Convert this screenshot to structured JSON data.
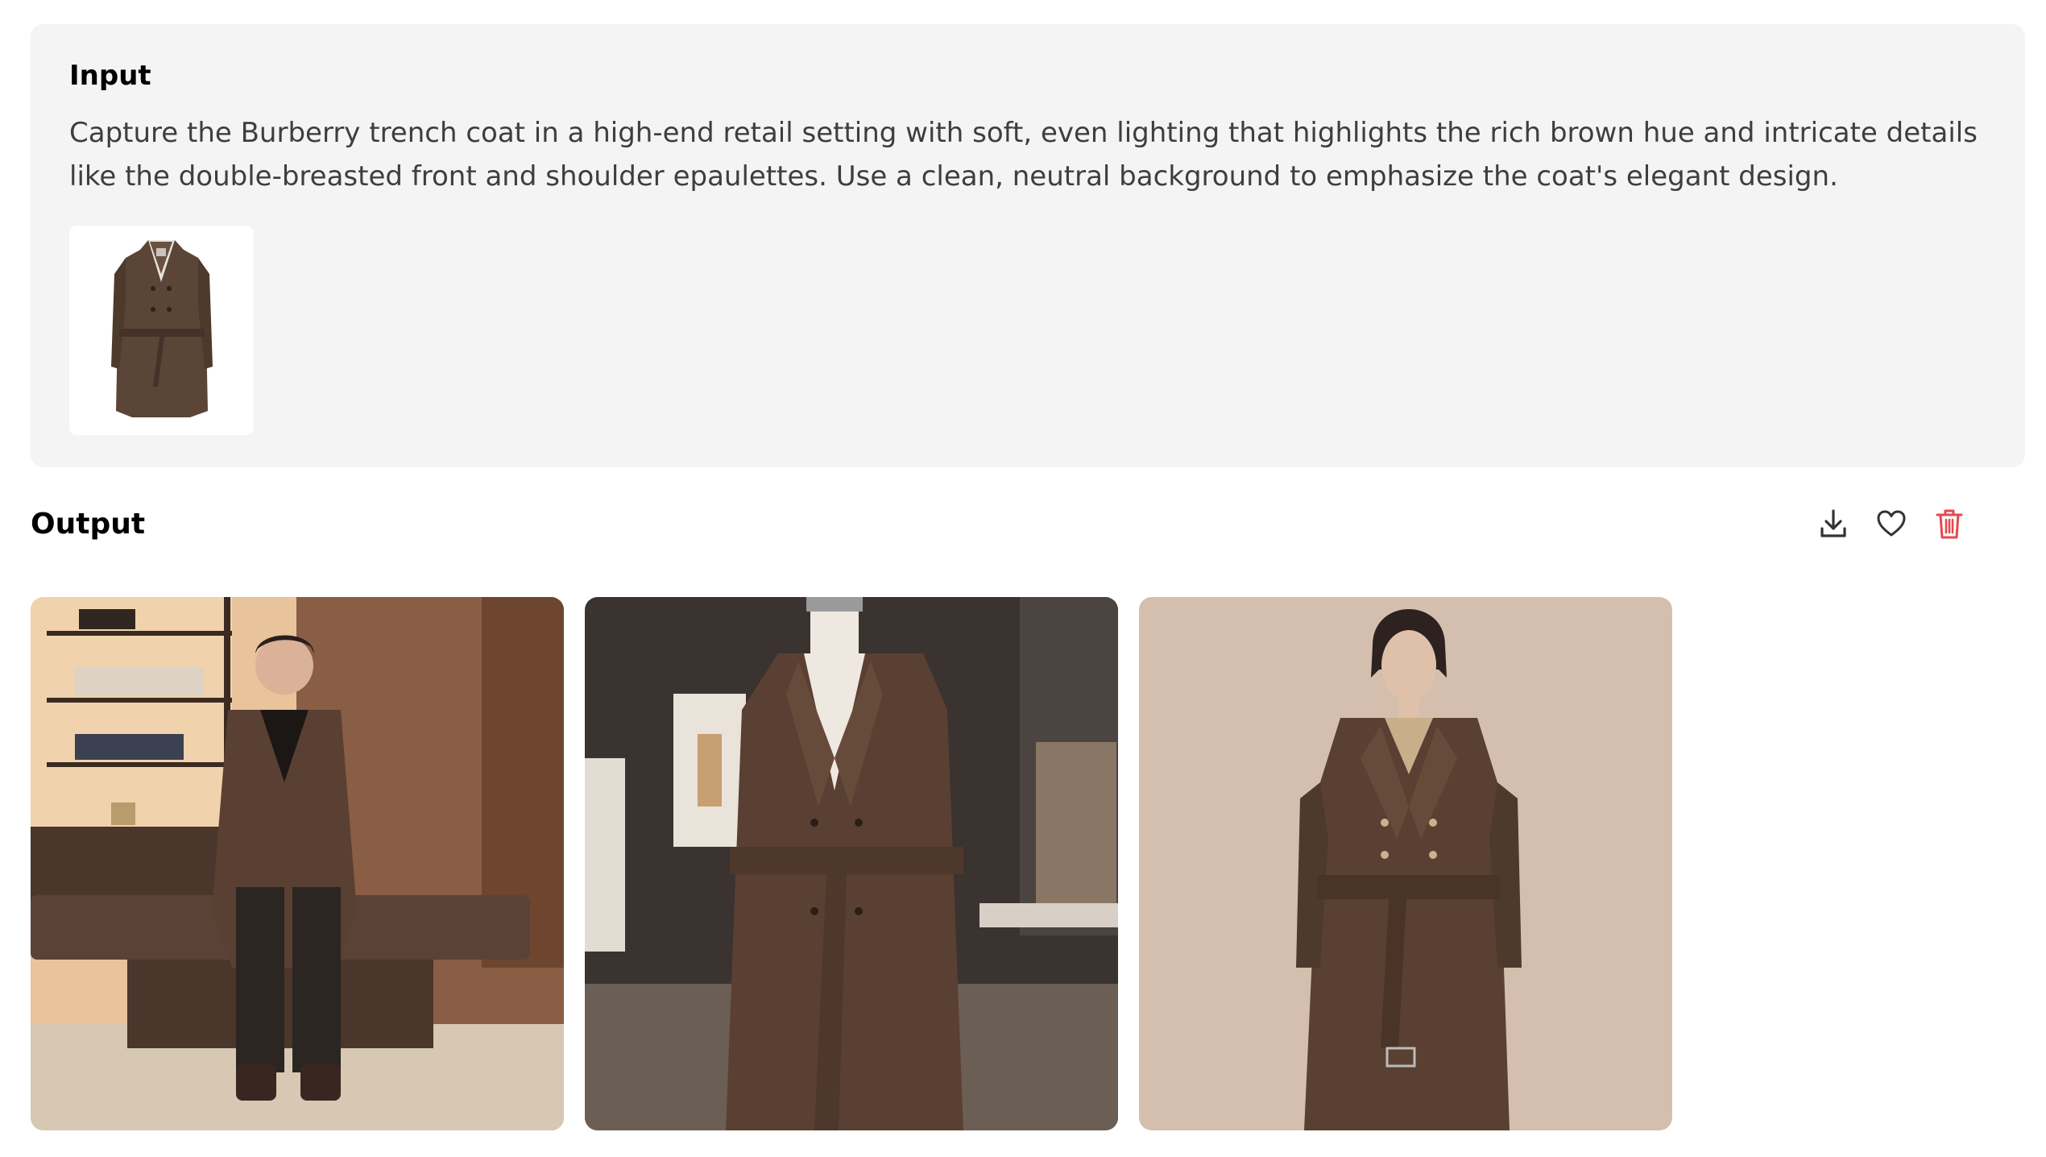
{
  "input": {
    "title": "Input",
    "prompt": "Capture the Burberry trench coat in a high-end retail setting with soft, even lighting that highlights the rich brown hue and intricate details like the double-breasted front and shoulder epaulettes. Use a clean, neutral background to emphasize the coat's elegant design.",
    "reference_image_icon": "trench-coat-product-photo"
  },
  "output": {
    "title": "Output",
    "actions": [
      {
        "icon": "download-icon"
      },
      {
        "icon": "heart-icon"
      },
      {
        "icon": "trash-icon",
        "color": "#e5484d"
      }
    ],
    "images": [
      {
        "icon": "man-seated-in-trench-coat-retail-shelves"
      },
      {
        "icon": "mannequin-trench-coat-boutique"
      },
      {
        "icon": "woman-in-trench-coat-beige-backdrop"
      }
    ]
  },
  "colors": {
    "card_bg": "#f4f4f4",
    "coat_brown": "#5a4032",
    "delete_red": "#e5484d"
  }
}
